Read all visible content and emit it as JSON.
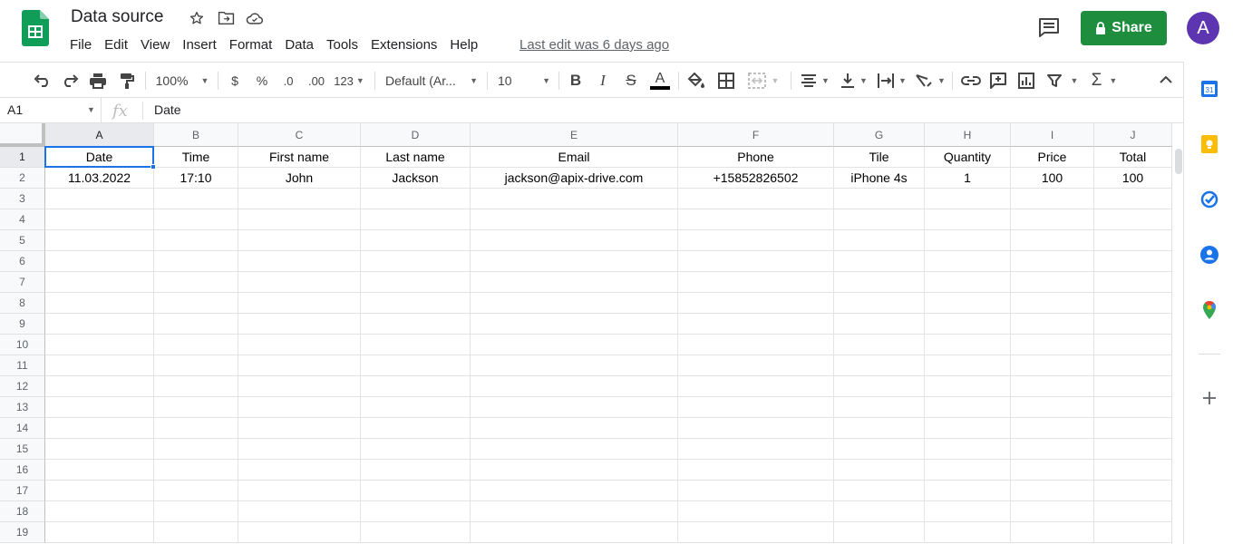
{
  "app": {
    "title": "Data source",
    "menu": [
      "File",
      "Edit",
      "View",
      "Insert",
      "Format",
      "Data",
      "Tools",
      "Extensions",
      "Help"
    ],
    "last_edit": "Last edit was 6 days ago",
    "share_label": "Share",
    "avatar_letter": "A"
  },
  "toolbar": {
    "zoom": "100%",
    "currency": "$",
    "percent": "%",
    "decrease_decimals": ".0",
    "increase_decimals": ".00",
    "more_formats": "123",
    "font": "Default (Ar...",
    "font_size": "10",
    "icons": [
      "undo-icon",
      "redo-icon",
      "print-icon",
      "paint-format-icon",
      "bold-icon",
      "italic-icon",
      "strikethrough-icon",
      "text-color-icon",
      "fill-color-icon",
      "borders-icon",
      "merge-cells-icon",
      "align-icon",
      "valign-icon",
      "text-wrap-icon",
      "text-rotation-icon",
      "link-icon",
      "comment-icon",
      "chart-icon",
      "filter-icon",
      "functions-icon"
    ]
  },
  "formula_bar": {
    "cell_ref": "A1",
    "fx": "fx",
    "value": "Date"
  },
  "sheet": {
    "columns": [
      "A",
      "B",
      "C",
      "D",
      "E",
      "F",
      "G",
      "H",
      "I",
      "J"
    ],
    "rows": [
      "1",
      "2",
      "3",
      "4",
      "5",
      "6",
      "7",
      "8",
      "9",
      "10",
      "11",
      "12",
      "13",
      "14",
      "15",
      "16",
      "17",
      "18",
      "19"
    ],
    "data": [
      [
        "Date",
        "Time",
        "First name",
        "Last name",
        "Email",
        "Phone",
        "Tile",
        "Quantity",
        "Price",
        "Total"
      ],
      [
        "11.03.2022",
        "17:10",
        "John",
        "Jackson",
        "jackson@apix-drive.com",
        "+15852826502",
        "iPhone 4s",
        "1",
        "100",
        "100"
      ]
    ],
    "selected_cell": "A1"
  },
  "side_panel": {
    "icons": [
      "calendar-icon",
      "keep-icon",
      "tasks-icon",
      "contacts-icon",
      "maps-icon",
      "add-icon"
    ],
    "calendar_day": "31"
  },
  "colors": {
    "share": "#1e8e3e",
    "avatar": "#5e35b1",
    "selection": "#1a73e8",
    "sheets_green": "#0f9d58"
  }
}
